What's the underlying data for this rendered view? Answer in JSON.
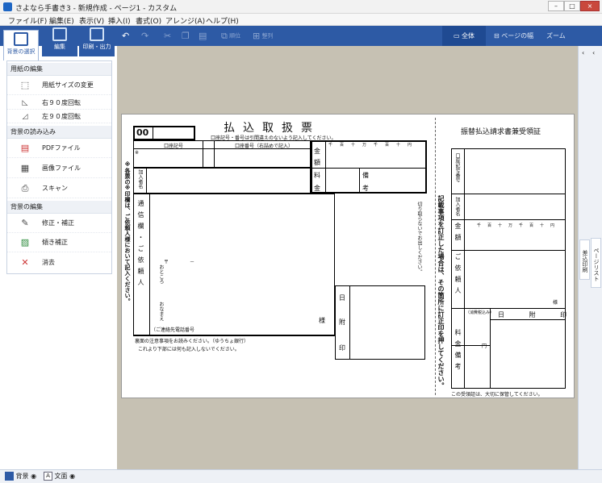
{
  "window": {
    "title": "さよなら手書き3 - 新規作成 - ページ1 - カスタム",
    "minimize": "–",
    "maximize": "□",
    "close": "×"
  },
  "menu": [
    "ファイル(F)",
    "編集(E)",
    "表示(V)",
    "挿入(I)",
    "書式(O)",
    "アレンジ(A)",
    "ヘルプ(H)"
  ],
  "toolbar": {
    "order_label": "順位",
    "align_label": "整列",
    "view_whole": "全体",
    "view_page_width": "ページの幅",
    "view_zoom": "ズーム"
  },
  "mode_tabs": [
    "背景の選択",
    "編集",
    "印刷・出力"
  ],
  "panel": {
    "paper_section": "用紙の編集",
    "paper_items": [
      "用紙サイズの変更",
      "右９０度回転",
      "左９０度回転"
    ],
    "load_section": "背景の読み込み",
    "load_items": [
      "PDFファイル",
      "画像ファイル",
      "スキャン"
    ],
    "edit_section": "背景の編集",
    "edit_items": [
      "修正・補正",
      "傾き補正",
      "消去"
    ]
  },
  "right_tabs": [
    "差込印刷",
    "ページリスト"
  ],
  "statusbar": {
    "background": "背景",
    "text": "文面"
  },
  "form": {
    "title": "払込取扱票",
    "code": "00",
    "note_top": "口座記号・番号は引間違えのないよう記入してください。",
    "account_symbol": "口座記号",
    "account_number": "口座番号（右詰めで記入）",
    "digits": [
      "千",
      "百",
      "十",
      "万",
      "千",
      "百",
      "十",
      "円"
    ],
    "amount_1": "金",
    "amount_2": "額",
    "fee_1": "料",
    "fee_2": "金",
    "remarks_1": "備",
    "remarks_2": "考",
    "subscriber_name": "加入者名",
    "comm_col": "通信欄・ご依頼人",
    "address": "おところ",
    "postal_mark": "〒",
    "dash": "－",
    "name_label": "おなまえ",
    "phone": "（ご連絡先電話番号",
    "honorific": "様",
    "date_1": "日",
    "date_2": "附",
    "date_3": "印",
    "left_vertical": "※各票の※印欄は、ご依頼人様において記入ください。",
    "back_note": "裏面の注意事項をお読みください。（ゆうちょ銀行）",
    "below_note": "これより下部には何も記入しないでください。",
    "cut_note": "切り取らないでお出しください。",
    "correction_note": "記載事項を訂正した場合は、その箇所に訂正印を押してください。",
    "receipt_title": "振替払込請求書兼受領証",
    "receipt_account": "口座記号番号",
    "receipt_subscriber": "加入者名",
    "receipt_amount": "金額",
    "receipt_client": "ご依頼人",
    "receipt_fee": "料金",
    "receipt_remarks": "備考",
    "receipt_postage": "（消費税込み）",
    "receipt_yen": "円",
    "receipt_date": "日 附 印",
    "receipt_note": "この受領証は、大切に保管してください。",
    "asterisk": "※"
  }
}
